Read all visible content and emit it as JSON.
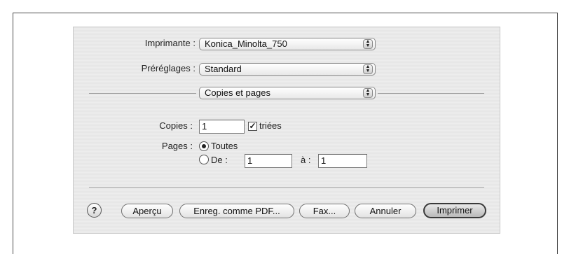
{
  "printer": {
    "label": "Imprimante :",
    "value": "Konica_Minolta_750"
  },
  "presets": {
    "label": "Préréglages :",
    "value": "Standard"
  },
  "panel": {
    "value": "Copies et pages"
  },
  "copies": {
    "label": "Copies :",
    "value": "1",
    "collated_label": "triées",
    "collated_checked": true
  },
  "pages": {
    "label": "Pages :",
    "all_label": "Toutes",
    "range_label": "De :",
    "from_value": "1",
    "to_label": "à :",
    "to_value": "1",
    "selected": "all"
  },
  "buttons": {
    "help": "?",
    "preview": "Aperçu",
    "save_pdf": "Enreg. comme PDF...",
    "fax": "Fax...",
    "cancel": "Annuler",
    "print": "Imprimer"
  }
}
